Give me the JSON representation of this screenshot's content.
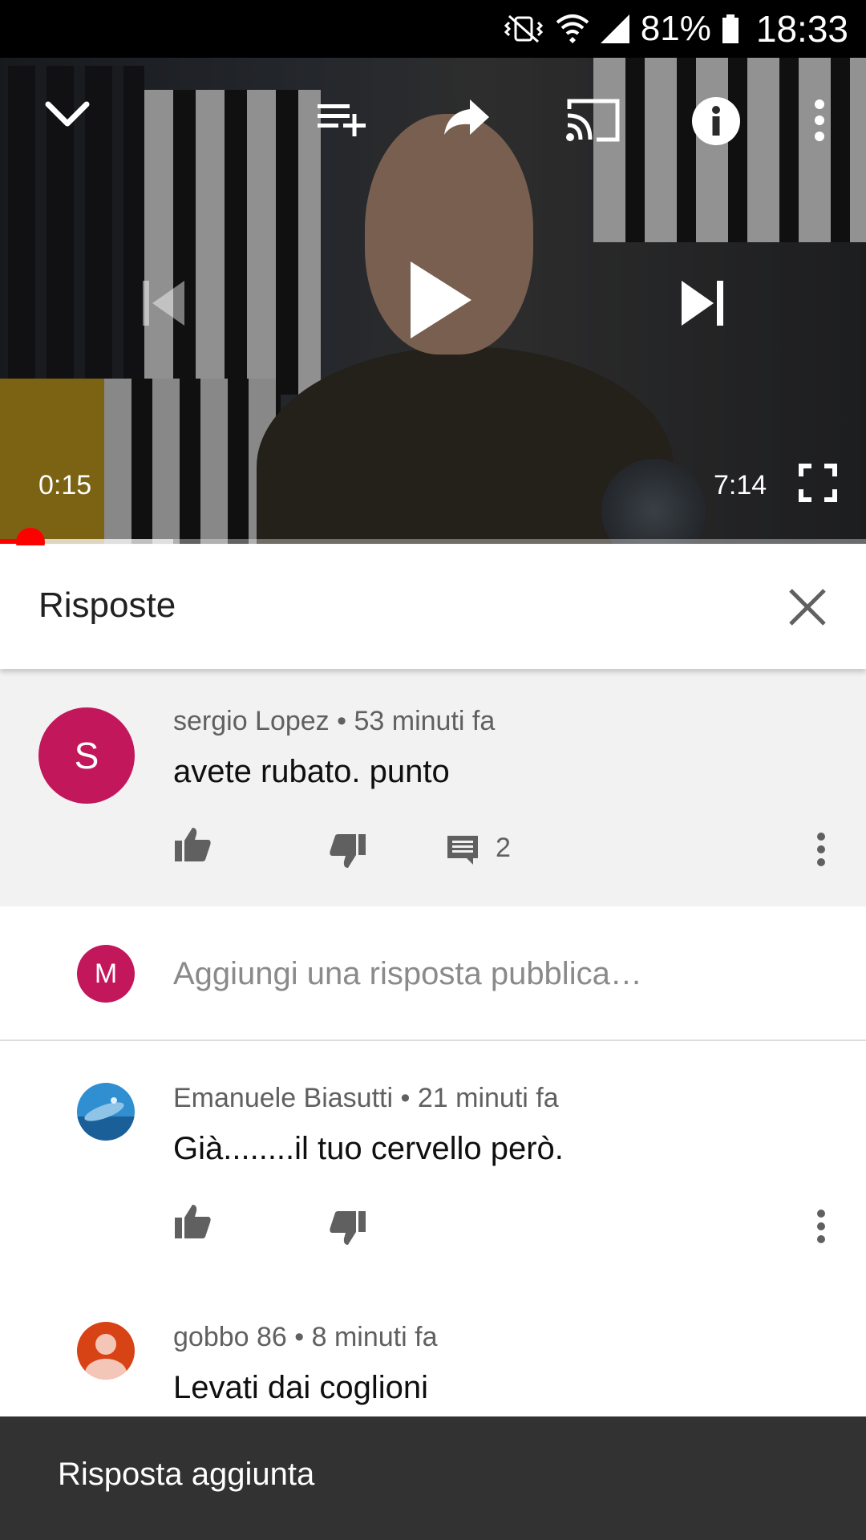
{
  "status_bar": {
    "battery": "81%",
    "time": "18:33"
  },
  "player": {
    "current_time": "0:15",
    "duration": "7:14",
    "played_fraction": 0.035,
    "buffered_fraction": 0.2
  },
  "replies_panel": {
    "title": "Risposte"
  },
  "parent_comment": {
    "avatar_letter": "S",
    "avatar_color": "#c2185b",
    "author": "sergio Lopez",
    "time": "53 minuti fa",
    "text": "avete rubato. punto",
    "reply_count": "2"
  },
  "add_reply": {
    "avatar_letter": "M",
    "avatar_color": "#c2185b",
    "placeholder": "Aggiungi una risposta pubblica…"
  },
  "replies": [
    {
      "author": "Emanuele Biasutti",
      "time": "21 minuti fa",
      "text": "Già........il tuo cervello però."
    },
    {
      "author": "gobbo 86",
      "time": "8 minuti fa",
      "text": "Levati dai coglioni"
    }
  ],
  "snackbar": {
    "message": "Risposta aggiunta"
  },
  "colors": {
    "progress_red": "#ff0000",
    "snackbar_bg": "#323232",
    "parent_bg": "#f2f2f2"
  }
}
